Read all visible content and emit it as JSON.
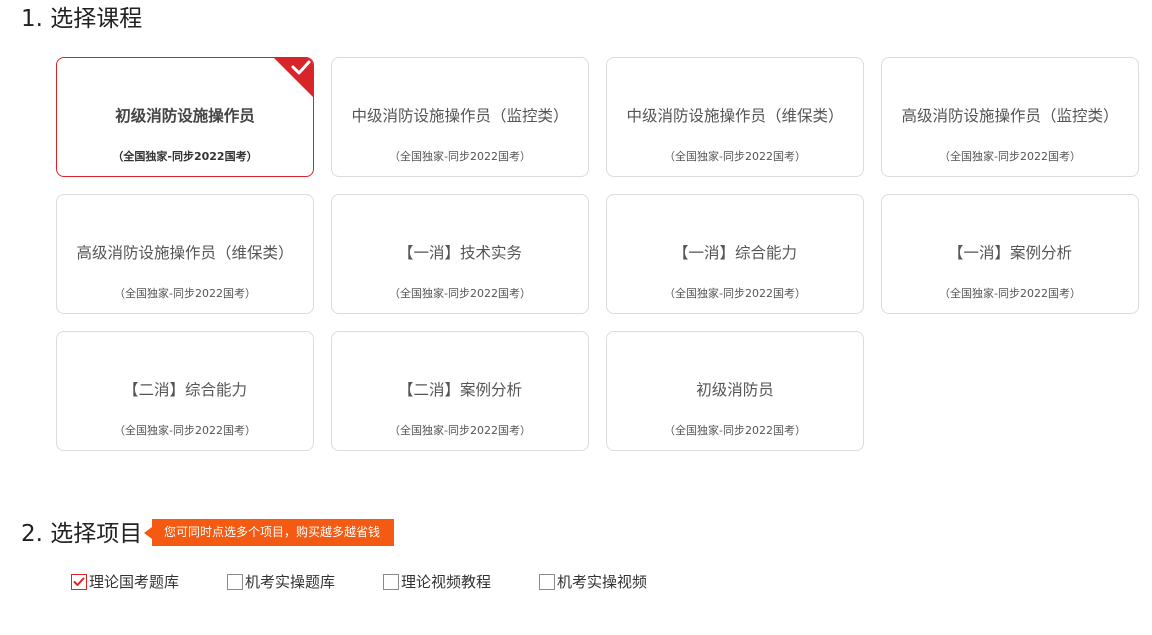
{
  "section1": {
    "title": "1. 选择课程"
  },
  "courses": [
    {
      "name": "初级消防设施操作员",
      "sub": "（全国独家-同步2022国考）",
      "selected": true
    },
    {
      "name": "中级消防设施操作员（监控类）",
      "sub": "（全国独家-同步2022国考）",
      "selected": false
    },
    {
      "name": "中级消防设施操作员（维保类）",
      "sub": "（全国独家-同步2022国考）",
      "selected": false
    },
    {
      "name": "高级消防设施操作员（监控类）",
      "sub": "（全国独家-同步2022国考）",
      "selected": false
    },
    {
      "name": "高级消防设施操作员（维保类）",
      "sub": "（全国独家-同步2022国考）",
      "selected": false
    },
    {
      "name": "【一消】技术实务",
      "sub": "（全国独家-同步2022国考）",
      "selected": false
    },
    {
      "name": "【一消】综合能力",
      "sub": "（全国独家-同步2022国考）",
      "selected": false
    },
    {
      "name": "【一消】案例分析",
      "sub": "（全国独家-同步2022国考）",
      "selected": false
    },
    {
      "name": "【二消】综合能力",
      "sub": "（全国独家-同步2022国考）",
      "selected": false
    },
    {
      "name": "【二消】案例分析",
      "sub": "（全国独家-同步2022国考）",
      "selected": false
    },
    {
      "name": "初级消防员",
      "sub": "（全国独家-同步2022国考）",
      "selected": false
    }
  ],
  "section2": {
    "title": "2. 选择项目",
    "tip": "您可同时点选多个项目，购买越多越省钱"
  },
  "projects": [
    {
      "label": "理论国考题库",
      "checked": true
    },
    {
      "label": "机考实操题库",
      "checked": false
    },
    {
      "label": "理论视频教程",
      "checked": false
    },
    {
      "label": "机考实操视频",
      "checked": false
    }
  ],
  "colors": {
    "accent_red": "#d9252a",
    "tip_orange": "#f45a12",
    "card_border": "#dcdcdc"
  }
}
